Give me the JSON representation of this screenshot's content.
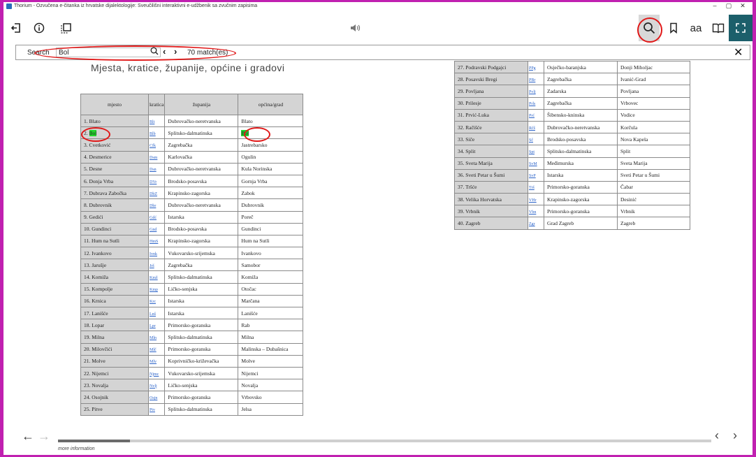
{
  "window": {
    "title": "Thorium - Ozvučena e-čitanka iz hrvatske dijalektologije: Sveučilišni interaktivni e-udžbenik sa zvučnim zapisima",
    "minimize": "–",
    "maximize": "▢",
    "close": "✕"
  },
  "toolbar": {
    "icons": [
      "back-to-library-icon",
      "info-icon",
      "table-of-contents-icon",
      "audio-icon",
      "search-icon",
      "bookmark-icon",
      "text-settings-icon",
      "reading-mode-icon",
      "fullscreen-icon"
    ],
    "text_settings_label": "aa",
    "accent": "#1c5f6b"
  },
  "search": {
    "label": "Search",
    "query": "Bol",
    "go": "🔍",
    "prev": "‹",
    "next": "›",
    "match_count": "70 match(es)",
    "close": "✕"
  },
  "document": {
    "heading": "Mjesta, kratice, županije, općine i gradovi",
    "columns": [
      "mjesto",
      "kratica",
      "županija",
      "općina/grad"
    ],
    "rows_left": [
      [
        "1. Blato",
        "Blt",
        "Dubrovačko-neretvanska",
        "Blato"
      ],
      [
        "2. Bol",
        "Blb",
        "Splitsko-dalmatinska",
        "Bol"
      ],
      [
        "3. Cvetković",
        "Cfk",
        "Zagrebačka",
        "Jastrebarsko"
      ],
      [
        "4. Desmerice",
        "Dsm",
        "Karlovačka",
        "Ogulin"
      ],
      [
        "5. Desne",
        "Dsn",
        "Dubrovačko-neretvanska",
        "Kula Norinska"
      ],
      [
        "6. Donja Vrba",
        "DVr",
        "Brodsko-posavska",
        "Gornja Vrba"
      ],
      [
        "7. Dubrava Zabočka",
        "DbZ",
        "Krapinsko-zagorska",
        "Zabok"
      ],
      [
        "8. Dubrovnik",
        "Dbr",
        "Dubrovačko-neretvanska",
        "Dubrovnik"
      ],
      [
        "9. Gedići",
        "Gdć",
        "Istarska",
        "Poreč"
      ],
      [
        "10. Gundinci",
        "Gnd",
        "Brodsko-posavska",
        "Gundinci"
      ],
      [
        "11. Hum na Sutli",
        "HmS",
        "Krapinsko-zagorska",
        "Hum na Sutli"
      ],
      [
        "12. Ivankovo",
        "Ivnk",
        "Vukovarsko-srijemska",
        "Ivankovo"
      ],
      [
        "13. Jarušje",
        "Jrš",
        "Zagrebačka",
        "Samobor"
      ],
      [
        "14. Komiža",
        "Kmž",
        "Splitsko-dalmatinska",
        "Komiža"
      ],
      [
        "15. Kompolje",
        "Kmp",
        "Ličko-senjska",
        "Otočac"
      ],
      [
        "16. Krnica",
        "Krc",
        "Istarska",
        "Marčana"
      ],
      [
        "17. Lanišće",
        "Lnš",
        "Istarska",
        "Lanišće"
      ],
      [
        "18. Lopar",
        "Lpr",
        "Primorsko-goranska",
        "Rab"
      ],
      [
        "19. Milna",
        "Mln",
        "Splitsko-dalmatinska",
        "Milna"
      ],
      [
        "20. Milovčići",
        "Mlč",
        "Primorsko-goranska",
        "Malinska – Dubašnica"
      ],
      [
        "21. Molve",
        "Mlv",
        "Koprivničko-križevačka",
        "Molve"
      ],
      [
        "22. Nijemci",
        "Njmc",
        "Vukovarsko-srijemska",
        "Nijemci"
      ],
      [
        "23. Novalja",
        "Nvlj",
        "Ličko-senjska",
        "Novalja"
      ],
      [
        "24. Osojnik",
        "Osjn",
        "Primorsko-goranska",
        "Vrbovsko"
      ],
      [
        "25. Pitve",
        "Ptv",
        "Splitsko-dalmatinska",
        "Jelsa"
      ]
    ],
    "rows_right": [
      [
        "27. Podravski Podgajci",
        "PPg",
        "Osječko-baranjska",
        "Donji Miholjac"
      ],
      [
        "28. Posavski Bregi",
        "PBr",
        "Zagrebačka",
        "Ivanić-Grad"
      ],
      [
        "29. Povljana",
        "Pvlj",
        "Zadarska",
        "Povljana"
      ],
      [
        "30. Prilesje",
        "Prls",
        "Zagrebačka",
        "Vrbovec"
      ],
      [
        "31. Prvić-Luka",
        "Prć",
        "Šibensko-kninska",
        "Vodice"
      ],
      [
        "32. Račišće",
        "Rčš",
        "Dubrovačko-neretvanska",
        "Korčula"
      ],
      [
        "33. Siče",
        "Sč",
        "Brodsko-posavska",
        "Nova Kapela"
      ],
      [
        "34. Split",
        "Spt",
        "Splitsko-dalmatinska",
        "Split"
      ],
      [
        "35. Sveta Marija",
        "SvM",
        "Međimurska",
        "Sveta Marija"
      ],
      [
        "36. Sveti Petar u Šumi",
        "SvP",
        "Istarska",
        "Sveti Petar u Šumi"
      ],
      [
        "37. Tršće",
        "Trš",
        "Primorsko-goranska",
        "Čabar"
      ],
      [
        "38. Velika Horvatska",
        "VHr",
        "Krapinsko-zagorska",
        "Desinić"
      ],
      [
        "39. Vrbnik",
        "Vbn",
        "Primorsko-goranska",
        "Vrbnik"
      ],
      [
        "40. Zagreb",
        "Zgr",
        "Grad Zagreb",
        "Zagreb"
      ]
    ],
    "highlight_color": "#22d52e"
  },
  "footer": {
    "back": "←",
    "forward": "→",
    "more_info": "more information",
    "page_prev": "‹",
    "page_next": "›",
    "progress": 0.11
  }
}
